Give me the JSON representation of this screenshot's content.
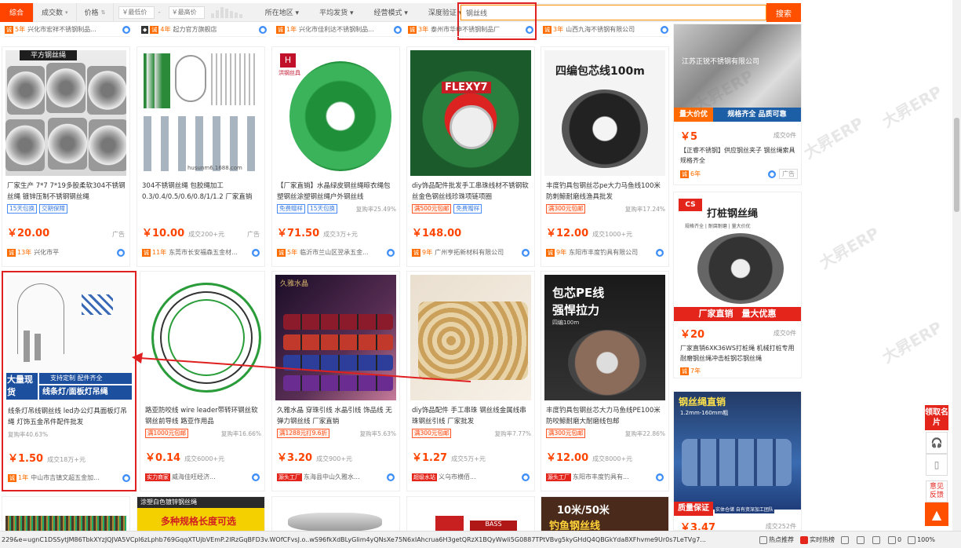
{
  "filter_bar": {
    "sort": [
      {
        "label": "综合",
        "active": true
      },
      {
        "label": "成交数",
        "arrow": "▾"
      },
      {
        "label": "价格",
        "arrow": "⇅"
      }
    ],
    "price_min_placeholder": "￥最低价",
    "price_dash": "-",
    "price_max_placeholder": "￥最高价",
    "filters": [
      "所在地区 ▾",
      "平均发货 ▾",
      "经营模式 ▾",
      "深度验证 ▾"
    ],
    "search_value": "钢丝线",
    "search_button": "搜索"
  },
  "top_strip": [
    {
      "years": "5年",
      "shop": "兴化市宏祥不锈钢制品..."
    },
    {
      "years": "4年",
      "shop": "起力官方旗舰店"
    },
    {
      "years": "1年",
      "shop": "兴化市佳利达不锈钢制品..."
    },
    {
      "years": "3年",
      "shop": "泰州市华申不锈钢制品厂"
    },
    {
      "years": "3年",
      "shop": "山西九海不锈钢有限公司"
    }
  ],
  "row1": [
    {
      "img_text": "平方钢丝绳",
      "title": "厂家生产 7*7 7*19多股柔软304不锈钢丝绳 镀锌压制不锈钢钢丝绳",
      "tags": [
        "15天包换",
        "交期保障"
      ],
      "price": "￥20.00",
      "sold": "",
      "ad": "广告",
      "years": "13年",
      "shop": "兴化市平"
    },
    {
      "img_text": "husunm6.1688.com",
      "title": "304不锈钢丝绳 包胶绳加工 0.3/0.4/0.5/0.6/0.8/1/1.2 厂家直销",
      "tags": [],
      "price": "￥10.00",
      "sold": "成交200+元",
      "ad": "广告",
      "years": "11年",
      "shop": "东莞市长安福森五金材..."
    },
    {
      "img_text": "洪钢丝具",
      "title": "【厂家直销】水晶绿皮钢丝绳晾衣绳包塑钢丝涂塑钢丝绳户外钢丝线",
      "tags": [
        "免费赠样",
        "15天包换"
      ],
      "rebuy": "复购率25.49%",
      "price": "￥71.50",
      "sold": "成交3万+元",
      "ad": "",
      "years": "5年",
      "shop": "临沂市兰山区翌承五金..."
    },
    {
      "img_text": "FLEXY7",
      "title": "diy饰品配件批发手工串珠线材不锈钢软丝金色钢丝线珍珠项链项圈",
      "tags": [
        "满500元包邮",
        "免费赠样"
      ],
      "price": "￥148.00",
      "sold": "",
      "ad": "",
      "years": "9年",
      "shop": "广州亨拓新材料有限公司"
    },
    {
      "img_text": "四编包芯线100m",
      "title": "丰度钓具包钢丝芯pe大力马鱼线100米 防刺鲸耐磨线渔具批发",
      "tags": [
        "满300元包邮"
      ],
      "rebuy": "复购率17.24%",
      "price": "￥12.00",
      "sold": "成交1000+元",
      "ad": "",
      "years": "9年",
      "shop": "东阳市丰度钓具有限公司"
    }
  ],
  "row2": [
    {
      "img_text": "大量现货",
      "img_sub": "支持定制 配件齐全",
      "img_sub2": "线条灯/面板灯吊绳",
      "title": "线条灯吊线钢丝线 led办公灯具面板灯吊绳 灯饰五金吊件配件批发",
      "tags": [],
      "rebuy": "复购率40.63%",
      "price": "￥1.50",
      "sold": "成交18万+元",
      "years": "1年",
      "shop": "中山市吉镇文超五金加..."
    },
    {
      "img_text": "",
      "title": "路亚防咬线 wire leader带转环钢丝软钢丝前导线 路亚作用品",
      "tags": [
        "满1000元包邮"
      ],
      "rebuy": "复购率16.66%",
      "price": "￥0.14",
      "sold": "成交6000+元",
      "badge": "实力商家",
      "years": "",
      "shop": "威海佳旺经济..."
    },
    {
      "img_text": "久雅水晶",
      "title": "久雅水晶 穿珠引线 水晶引线 饰品线 无弹力钢丝线 厂家直销",
      "tags": [
        "满1288元打9.6折"
      ],
      "rebuy": "复购率5.63%",
      "price": "￥3.20",
      "sold": "成交900+元",
      "badge": "源头工厂",
      "years": "",
      "shop": "东海县中山久雅水..."
    },
    {
      "img_text": "",
      "title": "diy饰品配件 手工串珠 钢丝线金属线串珠钢丝引线 厂家批发",
      "tags": [
        "满300元包邮"
      ],
      "rebuy": "复购率7.77%",
      "price": "￥1.27",
      "sold": "成交5万+元",
      "badge": "超级水站",
      "years": "",
      "shop": "义乌市横佰..."
    },
    {
      "img_text": "包芯PE线",
      "img_sub": "强悍拉力",
      "img_sub2": "四编100m",
      "title": "丰度钓具包钢丝芯大力马鱼线PE100米防咬鲸耐磨大耐磨线包邮",
      "tags": [
        "满300元包邮"
      ],
      "rebuy": "复购率22.86%",
      "price": "￥12.00",
      "sold": "成交8000+元",
      "badge": "源头工厂",
      "years": "",
      "shop": "东阳市丰度钓具有..."
    }
  ],
  "row3": [
    {
      "img_text": ""
    },
    {
      "img_text": "涂塑白色镀锌钢丝绳",
      "img_sub": "多种规格长度可选"
    },
    {
      "img_text": ""
    },
    {
      "img_text": "BASS"
    },
    {
      "img_text": "10米/50米",
      "img_sub": "钓鱼钢丝线"
    }
  ],
  "right_col": [
    {
      "img_text": "江苏正锐不锈钢有限公司",
      "banner": "量大价优",
      "banner2": "规格齐全 品质可靠",
      "price": "￥5",
      "sold": "成交0件",
      "title": "【正睿不锈钢】供应钢丝夹子 钢丝绳索具 规格齐全",
      "years": "6年",
      "ad": "广告"
    },
    {
      "img_text": "打桩钢丝绳",
      "img_sub": "规格齐全 | 耐腐耐磨 | 量大价优",
      "banner": "厂家直销",
      "banner2": "量大优惠",
      "price": "￥20",
      "sold": "成交0件",
      "title": "厂家直销6XK36WS打桩绳 机械打桩专用耐磨钢丝绳冲击桩钢芯钢丝绳",
      "years": "7年"
    },
    {
      "img_text": "钢丝绳直销",
      "img_sub": "1.2mm-160mm粗",
      "banner": "质量保证",
      "banner2": "实体仓储 自有资深加工团队",
      "price": "￥3.47",
      "sold": "成交252件"
    }
  ],
  "tools": {
    "ad_card": "领取名片",
    "feedback": "意见反馈",
    "to_top": "▲"
  },
  "status_bar": {
    "url": "229&e=ugnC1DSSytJM86TbkXYzJQJVA5VCpl6zLphb769GqqXTUjbVEmP.2lRzGqBFD3v.WOfCFvsJ.o..wS96fkXdBLyGlim4yQNsXe75N6xIAhcrua6H3getQRzX1BQyWwli5G0887TPtVBvg5kyGHdQ4QBGkYda8XFhvme9Ur0s7LeTVg7...",
    "hot": "热点推荐",
    "news": "实时热榜",
    "zoom": "100%",
    "count": "0"
  },
  "watermark": "大昇ERP"
}
